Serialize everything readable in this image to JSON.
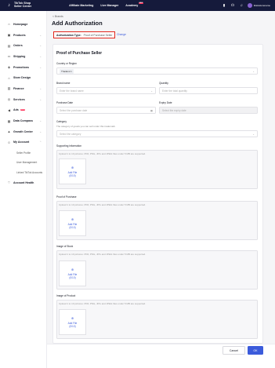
{
  "topbar": {
    "logo_text": "TikTok Shop\nSeller Center",
    "nav": [
      {
        "label": "Affiliate Marketing"
      },
      {
        "label": "Live Manager"
      },
      {
        "label": "Academy",
        "badge": "NEW"
      }
    ],
    "account_name": "tiktokstorename"
  },
  "sidebar": {
    "items": [
      {
        "label": "Homepage",
        "icon": "home-icon"
      },
      {
        "label": "Products",
        "icon": "box-icon"
      },
      {
        "label": "Orders",
        "icon": "clipboard-icon"
      },
      {
        "label": "Shipping",
        "icon": "truck-icon"
      },
      {
        "label": "Promotions",
        "icon": "tag-icon"
      },
      {
        "label": "Store Design",
        "icon": "store-icon"
      },
      {
        "label": "Finance",
        "icon": "wallet-icon"
      },
      {
        "label": "Services",
        "icon": "service-icon"
      },
      {
        "label": "Ads",
        "icon": "megaphone-icon",
        "badge": "NEW"
      },
      {
        "label": "Data Compass",
        "icon": "chart-icon"
      },
      {
        "label": "Growth Center",
        "icon": "growth-icon"
      },
      {
        "label": "My Account",
        "icon": "user-icon"
      }
    ],
    "subitems": [
      "Seller Profile",
      "User Management",
      "Linked TikTok Accounts"
    ],
    "account_health": {
      "label": "Account Health",
      "icon": "heart-icon"
    }
  },
  "header": {
    "back": "< Brands",
    "title": "Add Authorization",
    "auth_type_label": "Authorization Type:",
    "auth_type_value": "Proof of Purchase Seller",
    "change": "Change"
  },
  "form": {
    "section_title": "Proof of Purchase Seller",
    "country_label": "Country or Region",
    "country_value": "Thailand",
    "brand_label": "Brand name",
    "brand_placeholder": "Enter the brand name",
    "quantity_label": "Quantity",
    "quantity_placeholder": "Enter the total quantity",
    "purchase_date_label": "Purchase Date",
    "purchase_date_placeholder": "Select the purchase date",
    "expiry_label": "Expiry Date",
    "expiry_placeholder": "Select the expiry date",
    "category_label": "Category",
    "category_hint": "The category of goods you can sell under this trademark",
    "category_placeholder": "Select the category",
    "uploads": [
      {
        "label": "Supporting information",
        "count": "(0/10)"
      },
      {
        "label": "Proof of Purchase",
        "count": "(0/10)"
      },
      {
        "label": "Image of Stock",
        "count": "(0/10)"
      },
      {
        "label": "Image of Product",
        "count": "(0/10)"
      }
    ],
    "upload_hint": "Upload 1 to 10 pictures. PDF, PNG, JPG and JPEG files under 5 MB are supported.",
    "add_file": "Add File"
  },
  "footer": {
    "cancel": "Cancel",
    "ok": "OK"
  }
}
